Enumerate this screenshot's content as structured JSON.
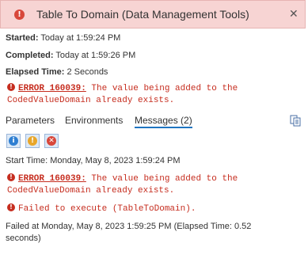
{
  "header": {
    "title": "Table To Domain (Data Management Tools)",
    "close": "✕"
  },
  "summary": {
    "started_label": "Started:",
    "started_value": "Today at 1:59:24 PM",
    "completed_label": "Completed:",
    "completed_value": "Today at 1:59:26 PM",
    "elapsed_label": "Elapsed Time:",
    "elapsed_value": "2 Seconds"
  },
  "summary_error": {
    "code": "ERROR 160039:",
    "text1": " The value being added to the",
    "text2": "CodedValueDomain already exists."
  },
  "tabs": [
    "Parameters",
    "Environments",
    "Messages (2)"
  ],
  "filters": [
    "i",
    "!",
    "✕"
  ],
  "messages": {
    "start": "Start Time: Monday, May 8, 2023 1:59:24 PM",
    "error_code": "ERROR 160039:",
    "error_text1": " The value being added to the",
    "error_text2": "CodedValueDomain already exists.",
    "failed": "Failed to execute (TableToDomain).",
    "end1": "Failed at Monday, May 8, 2023 1:59:25 PM (Elapsed Time: 0.52",
    "end2": "seconds)"
  },
  "colors": {
    "error": "#c62d1f",
    "header_bg": "#f7d4d3",
    "tab_underline": "#1f74c1"
  }
}
